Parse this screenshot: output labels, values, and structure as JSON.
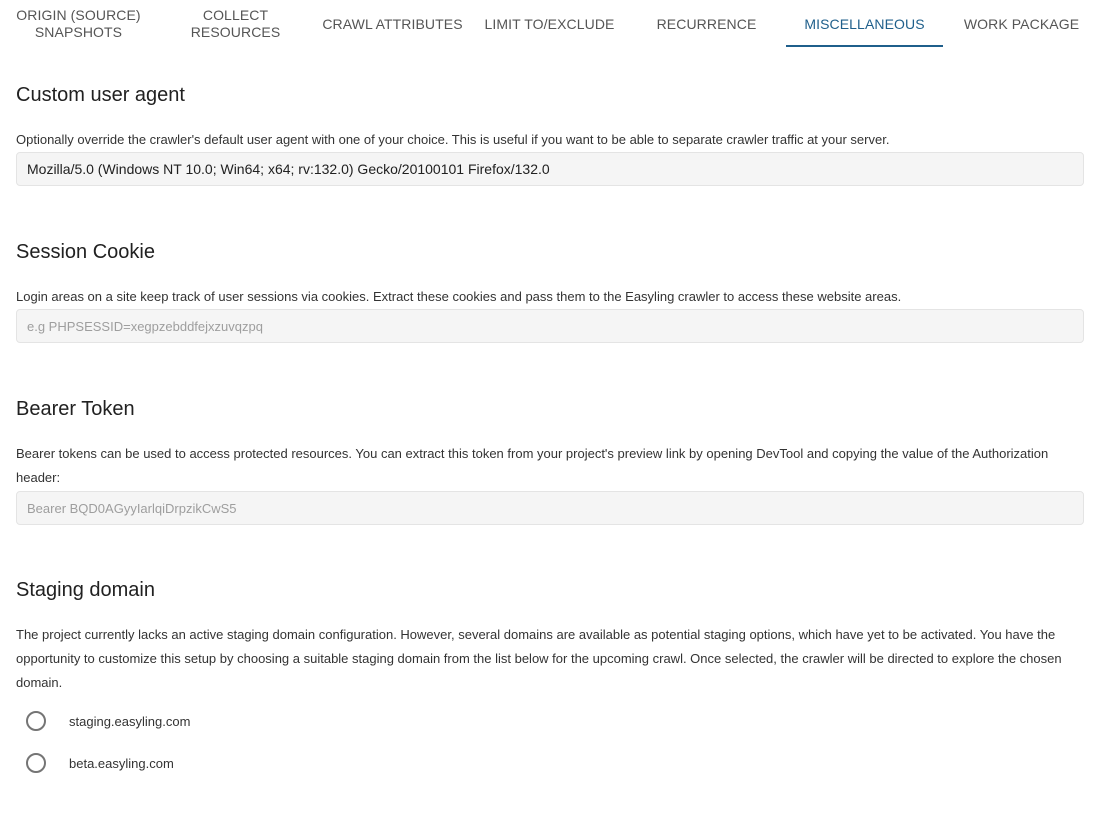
{
  "tabs": [
    {
      "label": "ORIGIN (SOURCE) SNAPSHOTS"
    },
    {
      "label": "COLLECT RESOURCES"
    },
    {
      "label": "CRAWL ATTRIBUTES"
    },
    {
      "label": "LIMIT TO/EXCLUDE"
    },
    {
      "label": "RECURRENCE"
    },
    {
      "label": "MISCELLANEOUS"
    },
    {
      "label": "WORK PACKAGE"
    }
  ],
  "active_tab": "MISCELLANEOUS",
  "accent_color": "#1f5f8b",
  "user_agent": {
    "title": "Custom user agent",
    "description": "Optionally override the crawler's default user agent with one of your choice. This is useful if you want to be able to separate crawler traffic at your server.",
    "value": "Mozilla/5.0 (Windows NT 10.0; Win64; x64; rv:132.0) Gecko/20100101 Firefox/132.0"
  },
  "session_cookie": {
    "title": "Session Cookie",
    "description": "Login areas on a site keep track of user sessions via cookies. Extract these cookies and pass them to the Easyling crawler to access these website areas.",
    "value": "",
    "placeholder": "e.g PHPSESSID=xegpzebddfejxzuvqzpq"
  },
  "bearer_token": {
    "title": "Bearer Token",
    "description": "Bearer tokens can be used to access protected resources. You can extract this token from your project's preview link by opening DevTool and copying the value of the Authorization header:",
    "value": "",
    "placeholder": "Bearer BQD0AGyyIarlqiDrpzikCwS5"
  },
  "staging_domain": {
    "title": "Staging domain",
    "description": "The project currently lacks an active staging domain configuration. However, several domains are available as potential staging options, which have yet to be activated. You have the opportunity to customize this setup by choosing a suitable staging domain from the list below for the upcoming crawl. Once selected, the crawler will be directed to explore the chosen domain.",
    "options": [
      {
        "label": "staging.easyling.com",
        "selected": false
      },
      {
        "label": "beta.easyling.com",
        "selected": false
      }
    ]
  }
}
